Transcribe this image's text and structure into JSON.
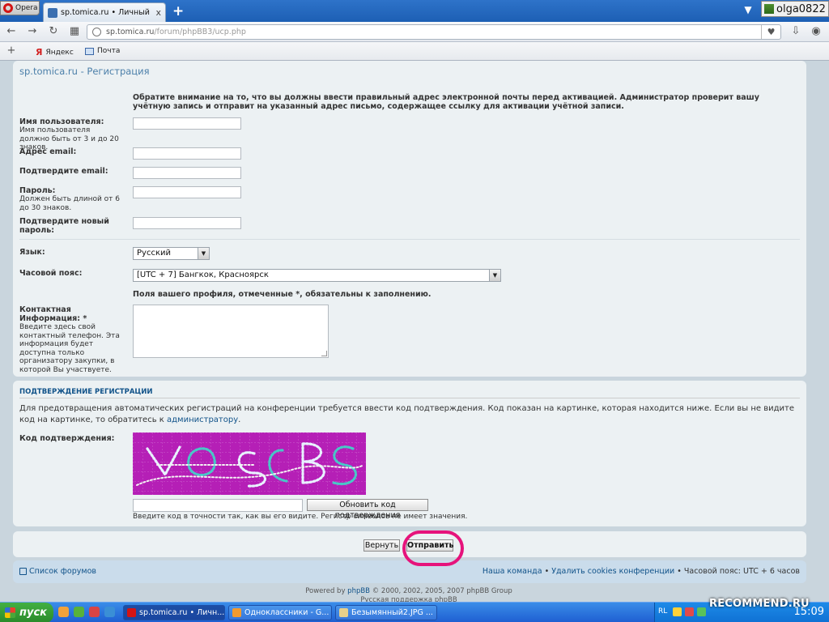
{
  "browser": {
    "menu_label": "Opera",
    "tab_title": "sp.tomica.ru • Личный разд...",
    "tab_close": "x",
    "new_tab": "+",
    "user_name": "olga0822",
    "url_host": "sp.tomica.ru",
    "url_path": "/forum/phpBB3/ucp.php",
    "bookmarks": [
      {
        "label": "Яндекс",
        "icon": "yandex-icon"
      },
      {
        "label": "Почта",
        "icon": "mail-icon"
      }
    ]
  },
  "page": {
    "site_title": "sp.tomica.ru - Регистрация",
    "email_notice": "Обратите внимание на то, что вы должны ввести правильный адрес электронной почты перед активацией. Администратор проверит вашу учётную запись и отправит на указанный адрес письмо, содержащее ссылку для активации учётной записи.",
    "fields": {
      "username_label": "Имя пользователя:",
      "username_hint": "Имя пользователя должно быть от 3 и до 20 знаков.",
      "email_label": "Адрес email:",
      "email_confirm_label": "Подтвердите email:",
      "password_label": "Пароль:",
      "password_hint": "Должен быть длиной от 6 до 30 знаков.",
      "password_confirm_label": "Подтвердите новый пароль:",
      "language_label": "Язык:",
      "language_value": "Русский",
      "timezone_label": "Часовой пояс:",
      "timezone_value": "[UTC + 7] Бангкок, Красноярск",
      "required_note": "Поля вашего профиля, отмеченные *, обязательны к заполнению.",
      "contact_label": "Контактная Информация: *",
      "contact_hint": "Введите здесь свой контактный телефон. Эта информация будет доступна только организатору закупки, в которой Вы участвуете."
    },
    "confirm": {
      "section_title": "Подтверждение регистрации",
      "text": "Для предотвращения автоматических регистраций на конференции требуется ввести код подтверждения. Код показан на картинке, которая находится ниже. Если вы не видите код на картинке, то обратитесь к",
      "admin_link": "администратору",
      "text_end": ".",
      "code_label": "Код подтверждения:",
      "refresh_button": "Обновить код подтверждения",
      "code_note": "Введите код в точности так, как вы его видите. Регистр символов не имеет значения."
    },
    "buttons": {
      "back": "Вернуть",
      "submit": "Отправить"
    },
    "footer": {
      "forum_list": "Список форумов",
      "team": "Наша команда",
      "delete_cookies": "Удалить cookies конференции",
      "bullet": " • ",
      "timezone": "Часовой пояс: UTC + 6 часов",
      "powered_prefix": "Powered by ",
      "powered_link": "phpBB",
      "powered_suffix": " © 2000, 2002, 2005, 2007 phpBB Group",
      "support": "Русская поддержка phpBB"
    }
  },
  "taskbar": {
    "start": "пуск",
    "tasks": [
      {
        "label": "sp.tomica.ru • Личн...",
        "active": true
      },
      {
        "label": "Одноклассники - G...",
        "active": false
      },
      {
        "label": "Безымянный2.JPG ...",
        "active": false
      }
    ],
    "lang": "RL",
    "clock": "15:09"
  },
  "watermark": "RECOMMEND.RU",
  "colors": {
    "accent": "#105289",
    "highlight_ring": "#e6137b",
    "captcha_bg": "#b51fb6"
  }
}
